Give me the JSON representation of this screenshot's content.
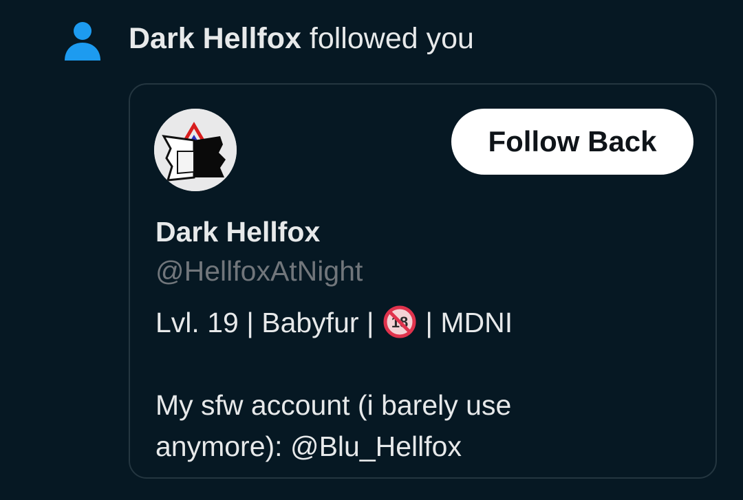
{
  "notification": {
    "icon": "person-icon",
    "name": "Dark Hellfox",
    "action": " followed you",
    "icon_color": "#1d9bf0"
  },
  "profile": {
    "display_name": "Dark Hellfox",
    "handle": "@HellfoxAtNight",
    "follow_button": "Follow Back",
    "bio": {
      "line1_a": "Lvl. 19 | Babyfur | ",
      "line1_emoji": "no-one-under-eighteen-icon",
      "line1_b": " | MDNI",
      "line3": "My sfw account (i barely use",
      "line4": "anymore): @Blu_Hellfox"
    }
  },
  "colors": {
    "background": "#061823",
    "text": "#e7e9ea",
    "muted": "#71767b",
    "border": "#243640",
    "button_bg": "#ffffff",
    "button_text": "#0f1419"
  }
}
